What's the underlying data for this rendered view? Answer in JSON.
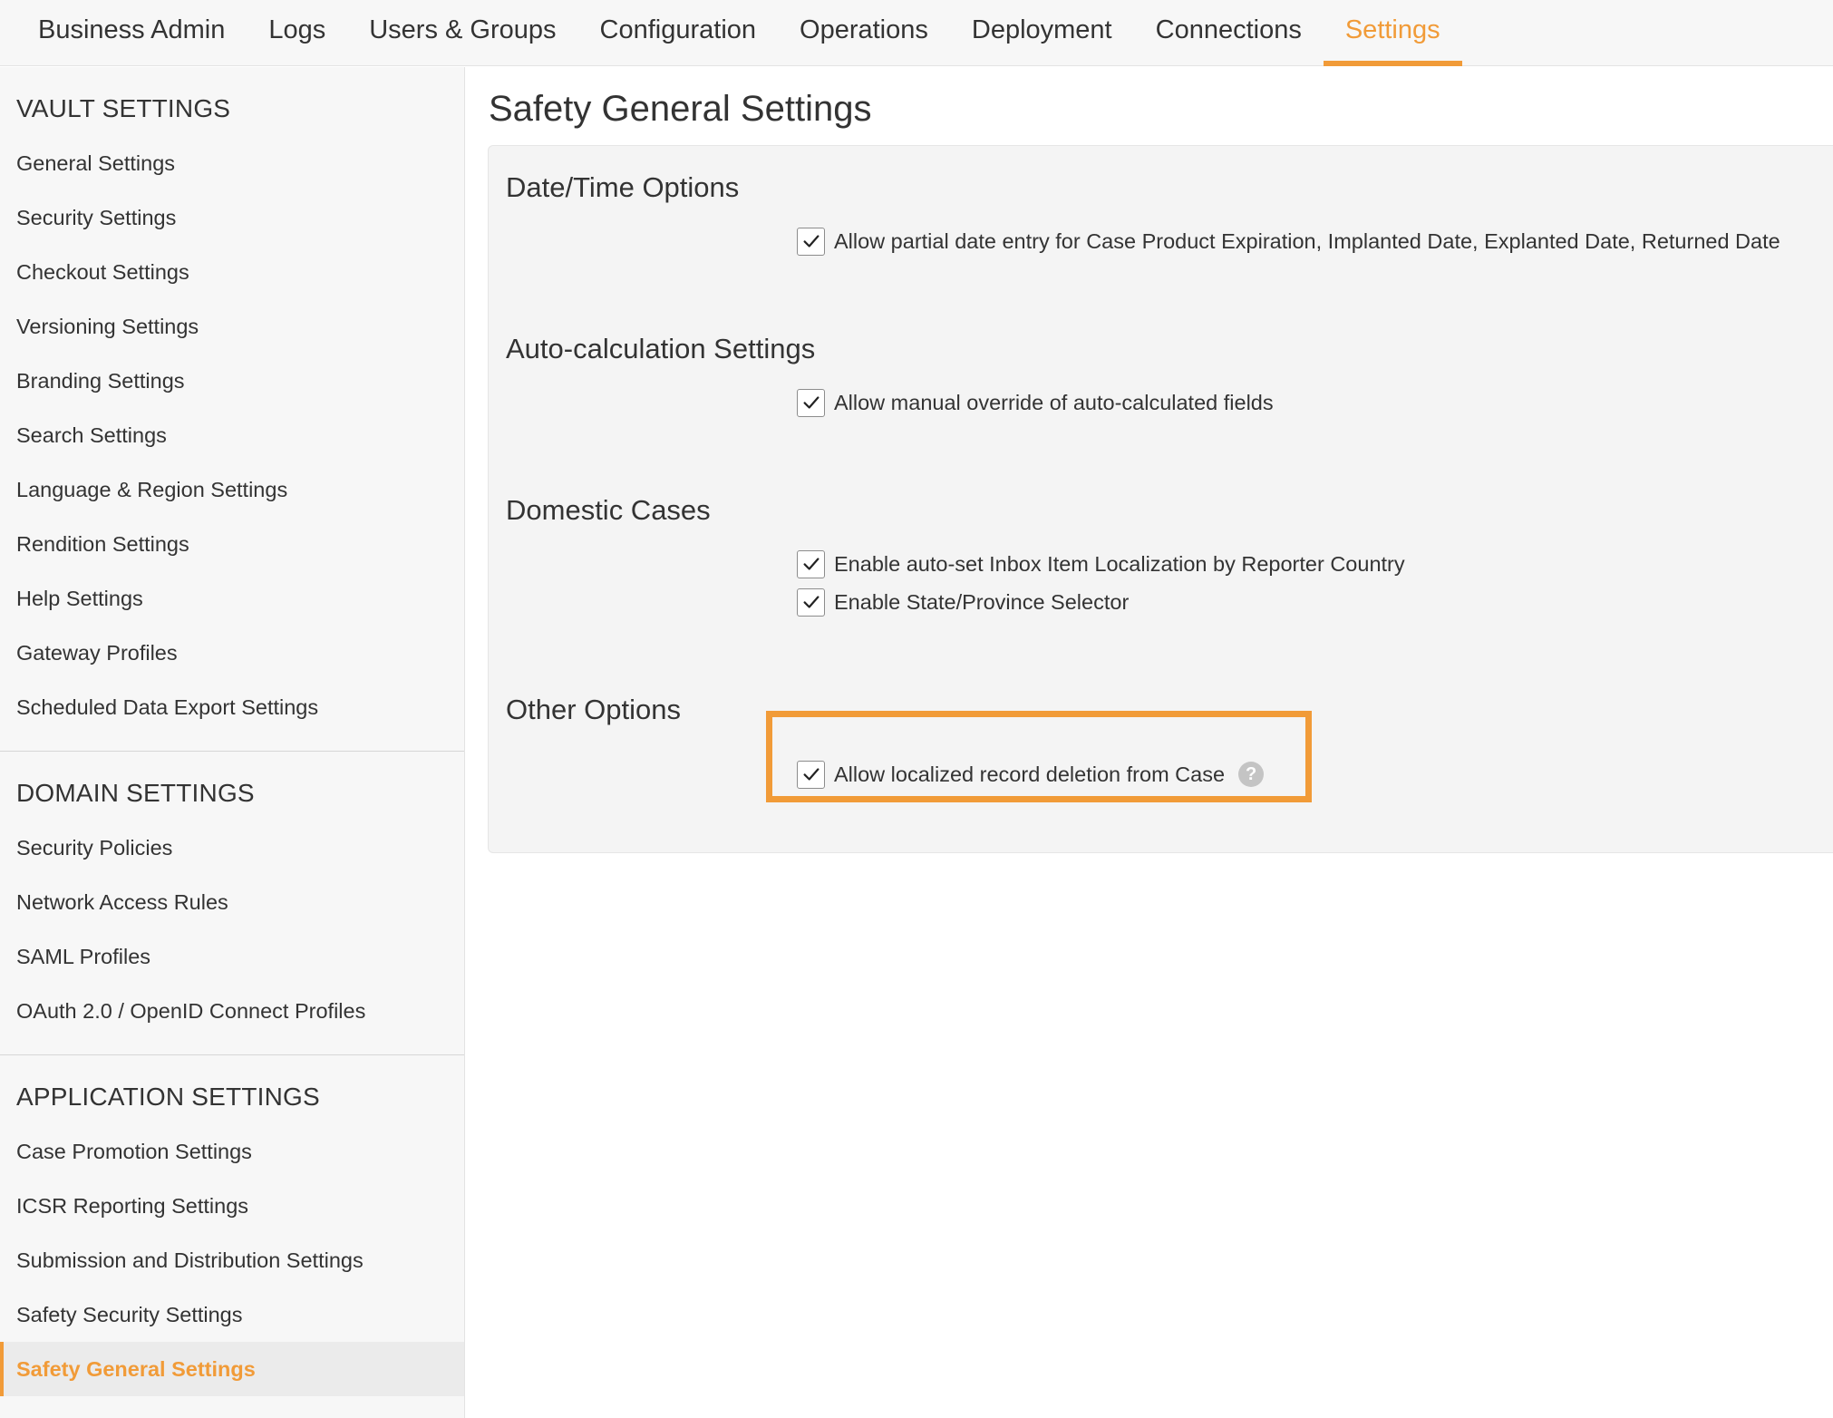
{
  "topnav": {
    "tabs": [
      {
        "label": "Business Admin"
      },
      {
        "label": "Logs"
      },
      {
        "label": "Users & Groups"
      },
      {
        "label": "Configuration"
      },
      {
        "label": "Operations"
      },
      {
        "label": "Deployment"
      },
      {
        "label": "Connections"
      },
      {
        "label": "Settings"
      }
    ],
    "active_tab": "Settings"
  },
  "sidebar": {
    "vault": {
      "heading": "VAULT SETTINGS",
      "items": [
        {
          "label": "General Settings"
        },
        {
          "label": "Security Settings"
        },
        {
          "label": "Checkout Settings"
        },
        {
          "label": "Versioning Settings"
        },
        {
          "label": "Branding Settings"
        },
        {
          "label": "Search Settings"
        },
        {
          "label": "Language & Region Settings"
        },
        {
          "label": "Rendition Settings"
        },
        {
          "label": "Help Settings"
        },
        {
          "label": "Gateway Profiles"
        },
        {
          "label": "Scheduled Data Export Settings"
        }
      ]
    },
    "domain": {
      "heading": "DOMAIN SETTINGS",
      "items": [
        {
          "label": "Security Policies"
        },
        {
          "label": "Network Access Rules"
        },
        {
          "label": "SAML Profiles"
        },
        {
          "label": "OAuth 2.0 / OpenID Connect Profiles"
        }
      ]
    },
    "application": {
      "heading": "APPLICATION SETTINGS",
      "items": [
        {
          "label": "Case Promotion Settings"
        },
        {
          "label": "ICSR Reporting Settings"
        },
        {
          "label": "Submission and Distribution Settings"
        },
        {
          "label": "Safety Security Settings"
        },
        {
          "label": "Safety General Settings"
        }
      ]
    }
  },
  "main": {
    "title": "Safety General Settings",
    "sections": {
      "datetime": {
        "title": "Date/Time Options",
        "options": [
          {
            "label": "Allow partial date entry for Case Product Expiration, Implanted Date, Explanted Date, Returned Date",
            "checked": true
          }
        ]
      },
      "autocalc": {
        "title": "Auto-calculation Settings",
        "options": [
          {
            "label": "Allow manual override of auto-calculated fields",
            "checked": true
          }
        ]
      },
      "domestic": {
        "title": "Domestic Cases",
        "options": [
          {
            "label": "Enable auto-set Inbox Item Localization by Reporter Country",
            "checked": true
          },
          {
            "label": "Enable State/Province Selector",
            "checked": true
          }
        ]
      },
      "other": {
        "title": "Other Options",
        "options": [
          {
            "label": "Allow localized record deletion from Case",
            "checked": true
          }
        ],
        "help_glyph": "?"
      }
    }
  },
  "colors": {
    "accent": "#f19b38",
    "text": "#333333",
    "panel_bg": "#f4f4f4",
    "sidebar_bg": "#f7f7f7"
  },
  "icons": {
    "checkbox": "check-icon",
    "help": "question-circle-icon"
  }
}
